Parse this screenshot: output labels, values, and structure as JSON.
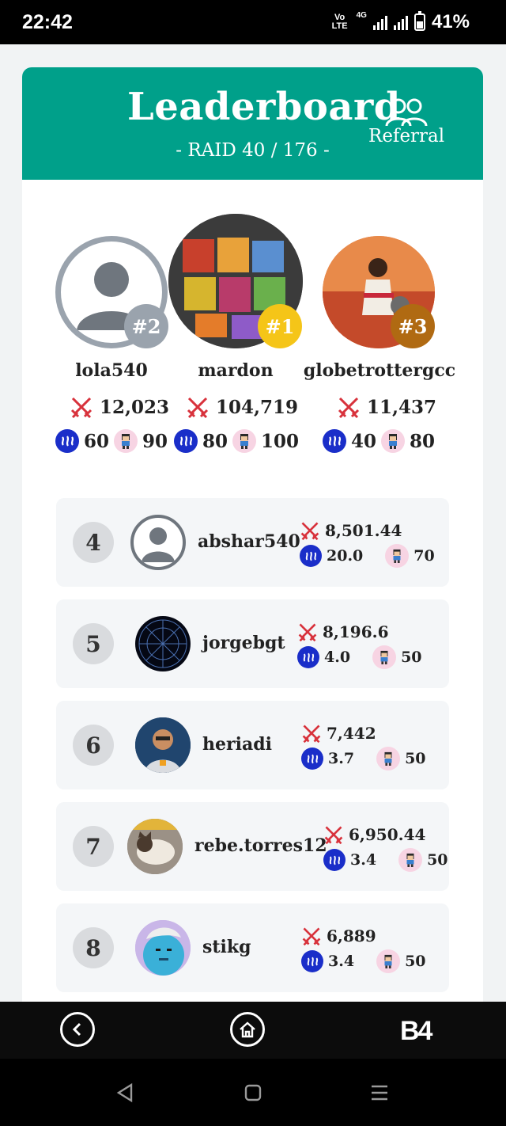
{
  "status_bar": {
    "time": "22:42",
    "network_label": "4G",
    "volte": "Vo LTE",
    "battery": "41%"
  },
  "header": {
    "title": "Leaderboard",
    "subtitle": "- RAID 40 / 176 -",
    "referral_label": "Referral"
  },
  "podium": [
    {
      "rank_label": "#2",
      "name": "lola540",
      "damage": "12,023",
      "steem": "60",
      "char": "90",
      "badge_color": "#9aa3ad"
    },
    {
      "rank_label": "#1",
      "name": "mardon",
      "damage": "104,719",
      "steem": "80",
      "char": "100",
      "badge_color": "#f5c518"
    },
    {
      "rank_label": "#3",
      "name": "globetrottergcc",
      "damage": "11,437",
      "steem": "40",
      "char": "80",
      "badge_color": "#b06a12"
    }
  ],
  "rows": [
    {
      "rank": "4",
      "name": "abshar540",
      "damage": "8,501.44",
      "steem": "20.0",
      "char": "70"
    },
    {
      "rank": "5",
      "name": "jorgebgt",
      "damage": "8,196.6",
      "steem": "4.0",
      "char": "50"
    },
    {
      "rank": "6",
      "name": "heriadi",
      "damage": "7,442",
      "steem": "3.7",
      "char": "50"
    },
    {
      "rank": "7",
      "name": "rebe.torres12",
      "damage": "6,950.44",
      "steem": "3.4",
      "char": "50"
    },
    {
      "rank": "8",
      "name": "stikg",
      "damage": "6,889",
      "steem": "3.4",
      "char": "50"
    }
  ],
  "app_bar": {
    "logo_text": "B4"
  },
  "colors": {
    "header_bg": "#00a08a",
    "steem_blue": "#1a2ec9",
    "sword_red": "#d8323c"
  },
  "icons": [
    "back-arrow-icon",
    "home-icon",
    "referral-icon",
    "steem-icon",
    "character-icon",
    "swords-icon"
  ]
}
